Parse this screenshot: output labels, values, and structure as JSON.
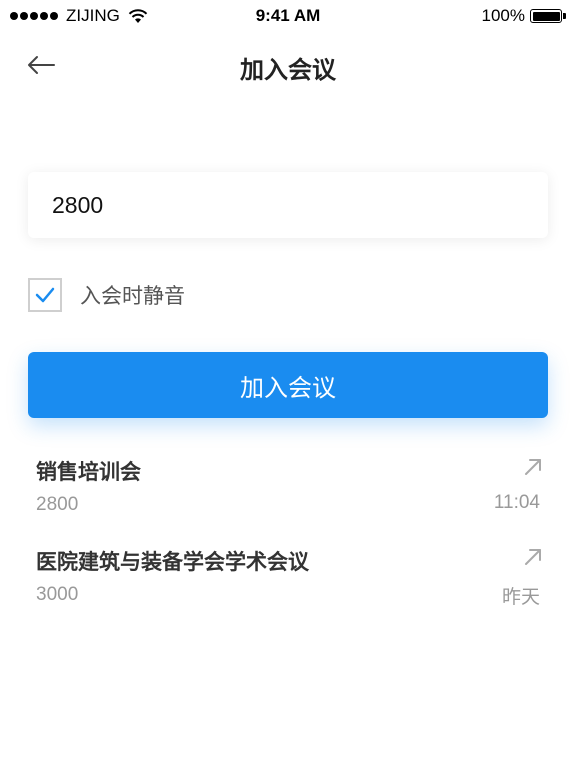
{
  "status_bar": {
    "carrier": "ZIJING",
    "time": "9:41 AM",
    "battery": "100%",
    "battery_level": 1.0
  },
  "nav": {
    "back_icon": "arrow-left-icon",
    "title": "加入会议"
  },
  "meeting_input": {
    "value": "2800",
    "placeholder": ""
  },
  "mute_option": {
    "label": "入会时静音",
    "checked": true
  },
  "join_button": {
    "label": "加入会议"
  },
  "history": [
    {
      "name": "销售培训会",
      "id": "2800",
      "time": "11:04",
      "icon": "arrow-up-right-icon"
    },
    {
      "name": "医院建筑与装备学会学术会议",
      "id": "3000",
      "time": "昨天",
      "icon": "arrow-up-right-icon"
    }
  ],
  "colors": {
    "accent": "#1a8cf0",
    "text_primary": "#333333",
    "text_secondary": "#999999"
  }
}
